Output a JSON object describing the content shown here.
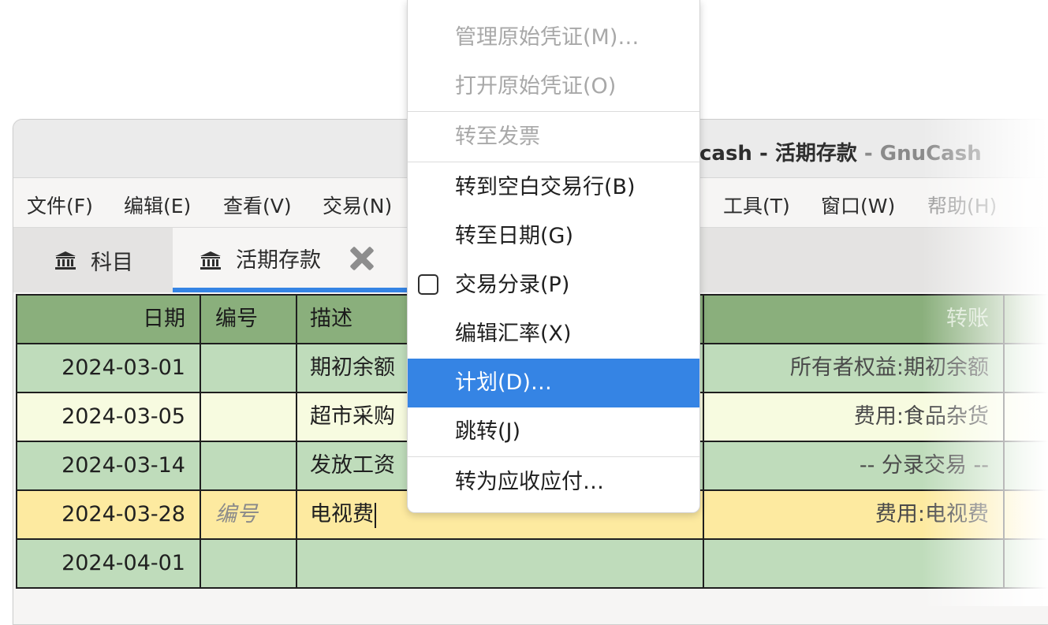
{
  "window": {
    "title_prefix": "cash - 活期存款",
    "title_app": " - GnuCash"
  },
  "menubar": {
    "items": [
      "文件(F)",
      "编辑(E)",
      "查看(V)",
      "交易(N)",
      "工具(T)",
      "窗口(W)",
      "帮助(H)"
    ]
  },
  "tabs": [
    {
      "label": "科目",
      "icon": "bank-icon"
    },
    {
      "label": "活期存款",
      "icon": "bank-icon",
      "closable": true
    }
  ],
  "register": {
    "headers": {
      "date": "日期",
      "num": "编号",
      "desc": "描述",
      "account": "转账"
    },
    "rows": [
      {
        "date": "2024-03-01",
        "num": "",
        "desc": "期初余额",
        "account": "所有者权益:期初余额"
      },
      {
        "date": "2024-03-05",
        "num": "",
        "desc": "超市采购",
        "account": "费用:食品杂货"
      },
      {
        "date": "2024-03-14",
        "num": "",
        "desc": "发放工资",
        "account": "-- 分录交易 --"
      },
      {
        "date": "2024-03-28",
        "num_placeholder": "编号",
        "desc": "电视费",
        "account": "费用:电视费"
      },
      {
        "date": "2024-04-01",
        "num": "",
        "desc": "",
        "account": ""
      }
    ]
  },
  "popup": {
    "items": [
      {
        "label": "管理原始凭证(M)…",
        "enabled": false
      },
      {
        "label": "打开原始凭证(O)",
        "enabled": false
      },
      {
        "label": "转至发票",
        "enabled": false
      },
      {
        "label": "转到空白交易行(B)",
        "enabled": true
      },
      {
        "label": "转至日期(G)",
        "enabled": true
      },
      {
        "label": "交易分录(P)",
        "enabled": true,
        "checkbox": true,
        "checked": false
      },
      {
        "label": "编辑汇率(X)",
        "enabled": true
      },
      {
        "label": "计划(D)…",
        "enabled": true,
        "highlighted": true
      },
      {
        "label": "跳转(J)",
        "enabled": true
      },
      {
        "label": "转为应收应付…",
        "enabled": true
      }
    ]
  },
  "colors": {
    "accent": "#3584e4",
    "header_bg": "#8aaf7c",
    "row_green": "#bfdcbb",
    "row_ivory": "#f7fbe0",
    "row_selected": "#fdeaa0"
  }
}
